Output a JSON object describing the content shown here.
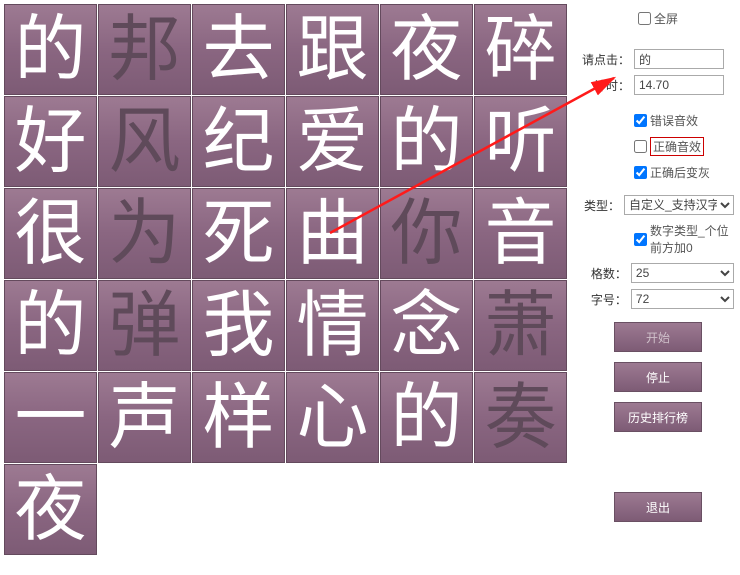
{
  "grid": {
    "rows": [
      [
        {
          "c": "的",
          "g": false
        },
        {
          "c": "邦",
          "g": true
        },
        {
          "c": "去",
          "g": false
        },
        {
          "c": "跟",
          "g": false
        },
        {
          "c": "夜",
          "g": false
        },
        {
          "c": "碎",
          "g": false
        }
      ],
      [
        {
          "c": "好",
          "g": false
        },
        {
          "c": "风",
          "g": true
        },
        {
          "c": "纪",
          "g": false
        },
        {
          "c": "爱",
          "g": false
        },
        {
          "c": "的",
          "g": false
        },
        {
          "c": "听",
          "g": false
        }
      ],
      [
        {
          "c": "很",
          "g": false
        },
        {
          "c": "为",
          "g": true
        },
        {
          "c": "死",
          "g": false
        },
        {
          "c": "曲",
          "g": false
        },
        {
          "c": "你",
          "g": true
        },
        {
          "c": "音",
          "g": false
        }
      ],
      [
        {
          "c": "的",
          "g": false
        },
        {
          "c": "弹",
          "g": true
        },
        {
          "c": "我",
          "g": false
        },
        {
          "c": "情",
          "g": false
        },
        {
          "c": "念",
          "g": false
        },
        {
          "c": "萧",
          "g": true
        }
      ],
      [
        {
          "c": "一",
          "g": false
        },
        {
          "c": "声",
          "g": false
        },
        {
          "c": "样",
          "g": false
        },
        {
          "c": "心",
          "g": false
        },
        {
          "c": "的",
          "g": false
        },
        {
          "c": "奏",
          "g": true
        }
      ]
    ],
    "extra": [
      {
        "c": "夜",
        "g": false
      }
    ]
  },
  "sidebar": {
    "fullscreen_label": "全屏",
    "fullscreen_checked": false,
    "prompt_label": "请点击：",
    "prompt_value": "的",
    "timer_label": "计时：",
    "timer_value": "14.70",
    "err_sound_label": "错误音效",
    "err_sound_checked": true,
    "ok_sound_label": "正确音效",
    "ok_sound_checked": false,
    "greyout_label": "正确后变灰",
    "greyout_checked": true,
    "type_label": "类型：",
    "type_value": "自定义_支持汉字",
    "numpad_label": "数字类型_个位前方加0",
    "numpad_checked": true,
    "grid_label": "格数：",
    "grid_value": "25",
    "font_label": "字号：",
    "font_value": "72",
    "start_btn": "开始",
    "stop_btn": "停止",
    "history_btn": "历史排行榜",
    "exit_btn": "退出"
  }
}
